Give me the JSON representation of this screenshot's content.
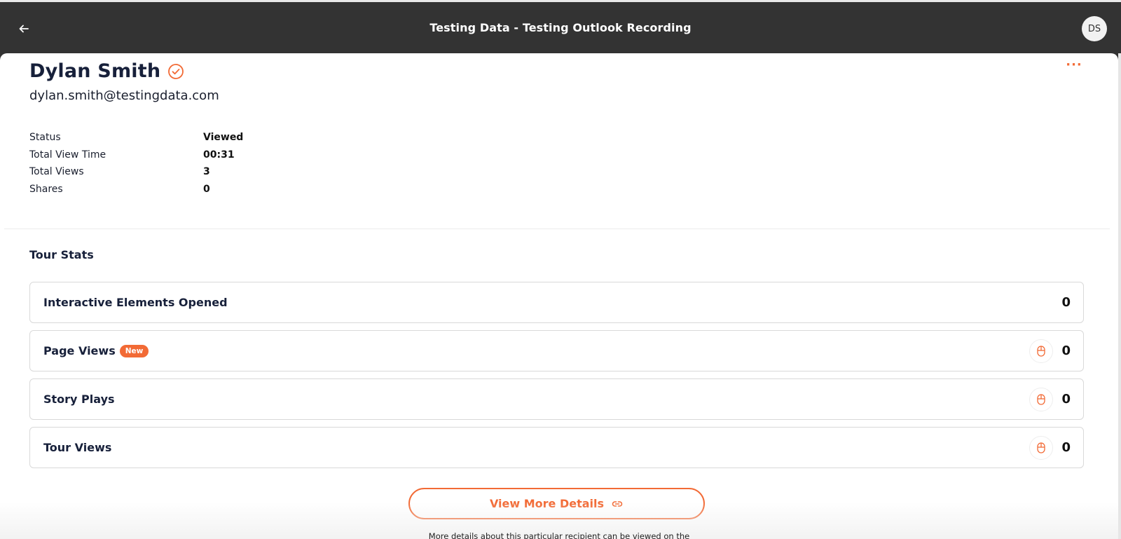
{
  "header": {
    "title": "Testing Data - Testing Outlook Recording",
    "avatar_initials": "DS",
    "back_icon": "arrow-left-icon"
  },
  "recipient": {
    "name": "Dylan Smith",
    "email": "dylan.smith@testingdata.com",
    "verified_icon": "check-circle-icon",
    "more_label": "···"
  },
  "stats": [
    {
      "label": "Status",
      "value": "Viewed"
    },
    {
      "label": "Total View Time",
      "value": "00:31"
    },
    {
      "label": "Total Views",
      "value": "3"
    },
    {
      "label": "Shares",
      "value": "0"
    }
  ],
  "tour_stats": {
    "title": "Tour Stats",
    "items": [
      {
        "label": "Interactive Elements Opened",
        "value": "0",
        "badge": "",
        "icon": ""
      },
      {
        "label": "Page Views",
        "value": "0",
        "badge": "New",
        "icon": "mouse-icon"
      },
      {
        "label": "Story Plays",
        "value": "0",
        "badge": "",
        "icon": "mouse-icon"
      },
      {
        "label": "Tour Views",
        "value": "0",
        "badge": "",
        "icon": "mouse-icon"
      }
    ]
  },
  "view_more": {
    "label": "View More Details",
    "icon": "link-icon"
  },
  "footnote": "More details about this particular recipient can be viewed on the",
  "colors": {
    "accent": "#f26a35",
    "topbar": "#333333",
    "text_dark": "#17203a"
  }
}
